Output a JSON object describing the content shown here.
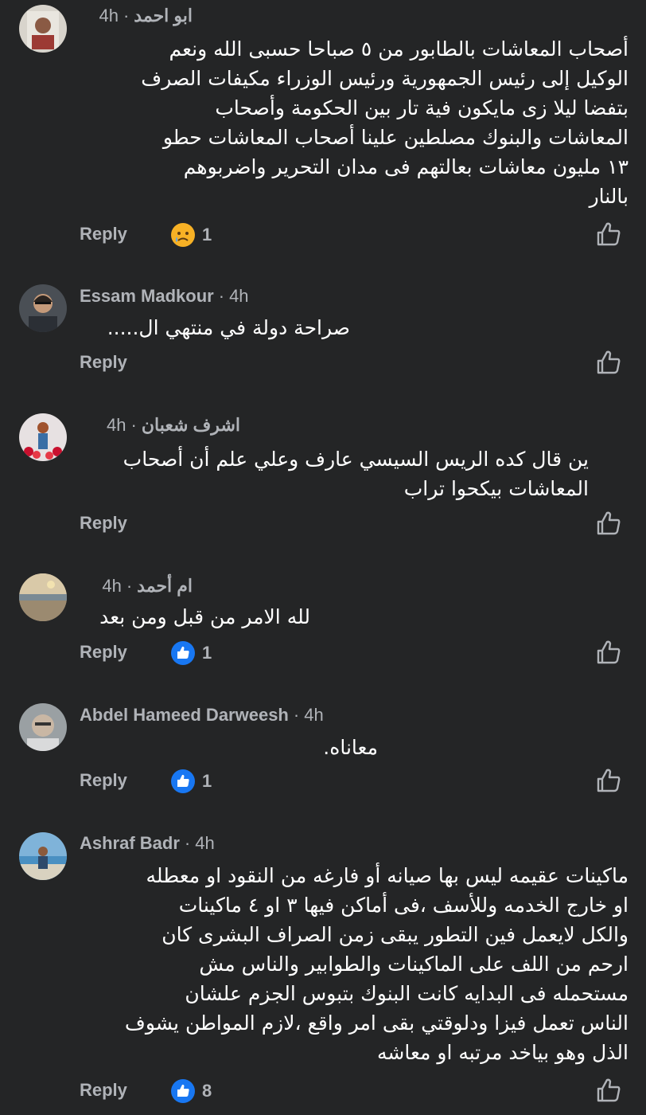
{
  "ui": {
    "reply_label": "Reply",
    "meta_separator": "·"
  },
  "comments": [
    {
      "author": "ابو احمد",
      "time": "4h",
      "text": "أصحاب المعاشات بالطابور من ٥ صباحا حسبى الله ونعم\nالوكيل إلى رئيس الجمهورية ورئيس الوزراء مكيفات الصرف\nبتفضا ليلا زى مايكون فية تار بين الحكومة وأصحاب\nالمعاشات والبنوك مصلطين علينا أصحاب المعاشات حطو\n١٣ مليون معاشات بعالتهم فى مدان التحرير واضربوهم\nبالنار",
      "reaction": {
        "icon": "sad-emoji-icon",
        "count": "1"
      }
    },
    {
      "author": "Essam Madkour",
      "time": "4h",
      "text": "صراحة دولة في منتهي ال.....",
      "reaction": null
    },
    {
      "author": "اشرف  شعبان",
      "time": "4h",
      "text": "ين قال كده الريس السيسي عارف وعلي علم أن أصحاب\nالمعاشات بيكحوا تراب",
      "reaction": null
    },
    {
      "author": "ام أحمد",
      "time": "4h",
      "text": "لله الامر من قبل ومن بعد",
      "reaction": {
        "icon": "like-reaction-icon",
        "count": "1"
      }
    },
    {
      "author": "Abdel Hameed Darweesh",
      "time": "4h",
      "text": "معاناه.",
      "reaction": {
        "icon": "like-reaction-icon",
        "count": "1"
      }
    },
    {
      "author": "Ashraf Badr",
      "time": "4h",
      "text": "ماكينات عقيمه ليس بها صيانه أو فارغه من النقود او معطله\nاو خارج الخدمه وللأسف ،فى أماكن فيها ٣ او ٤ ماكينات\nوالكل لايعمل  فين التطور يبقى زمن الصراف البشرى كان\nارحم من اللف على الماكينات والطوابير والناس مش\nمستحمله  فى البدايه كانت البنوك بتبوس الجزم علشان\nالناس تعمل فيزا ودلوقتي بقى امر واقع ،لازم المواطن يشوف\nالذل وهو بياخد مرتبه او معاشه",
      "reaction": {
        "icon": "like-reaction-icon",
        "count": "8"
      }
    }
  ],
  "colors": {
    "background": "#242526",
    "text_primary": "#ffffff",
    "text_secondary": "#b0b3b8",
    "like_blue": "#1877f2",
    "sad_yellow": "#f7b125"
  }
}
